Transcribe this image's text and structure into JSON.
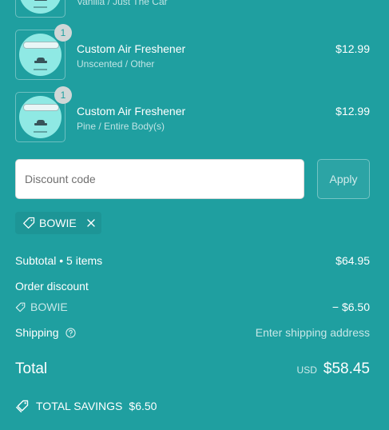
{
  "items": [
    {
      "title": "",
      "variant": "Vanilla / Just The Car",
      "price": "",
      "quantity": ""
    },
    {
      "title": "Custom Air Freshener",
      "variant": "Unscented / Other",
      "price": "$12.99",
      "quantity": "1"
    },
    {
      "title": "Custom Air Freshener",
      "variant": "Pine / Entire Body(s)",
      "price": "$12.99",
      "quantity": "1"
    }
  ],
  "discount": {
    "placeholder": "Discount code",
    "apply_label": "Apply",
    "applied_code": "BOWIE"
  },
  "summary": {
    "subtotal_label": "Subtotal",
    "items_count": "• 5 items",
    "subtotal_value": "$64.95",
    "order_discount_label": "Order discount",
    "discount_code": "BOWIE",
    "discount_value": "− $6.50",
    "shipping_label": "Shipping",
    "shipping_value": "Enter shipping address",
    "total_label": "Total",
    "currency": "USD",
    "total_value": "$58.45",
    "savings_label": "TOTAL SAVINGS",
    "savings_value": "$6.50"
  },
  "icons": {
    "tag": "tag-icon",
    "close": "close-icon",
    "help": "help-circle-icon",
    "savings": "savings-tag-icon"
  },
  "colors": {
    "background": "#1f9fa0",
    "product_disc": "#8fe9e4",
    "qty_badge": "#d0d7d7",
    "text": "#ffffff"
  }
}
